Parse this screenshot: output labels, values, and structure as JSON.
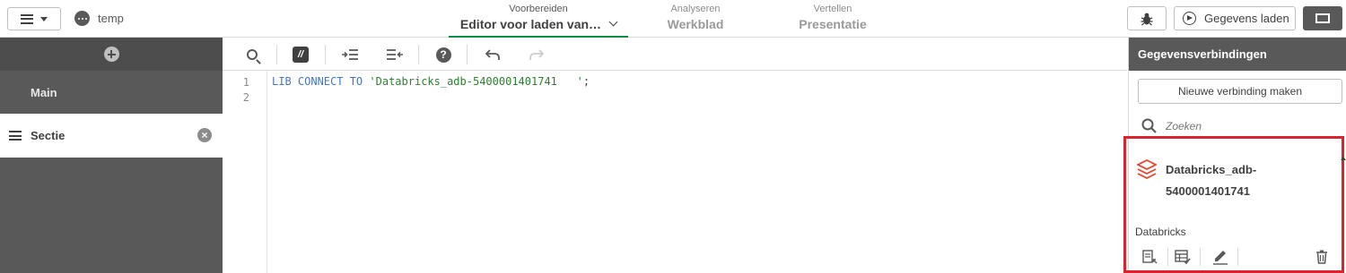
{
  "app": {
    "name": "temp"
  },
  "nav": {
    "tabs": [
      {
        "small": "Voorbereiden",
        "label": "Editor voor laden van…",
        "active": true
      },
      {
        "small": "Analyseren",
        "label": "Werkblad",
        "active": false
      },
      {
        "small": "Vertellen",
        "label": "Presentatie",
        "active": false
      }
    ]
  },
  "actions": {
    "load_label": "Gegevens laden"
  },
  "sections": {
    "items": [
      {
        "label": "Main",
        "active": false
      },
      {
        "label": "Sectie",
        "active": true
      }
    ]
  },
  "editor": {
    "line_numbers": [
      "1",
      "2"
    ],
    "code": {
      "kw1": "LIB CONNECT TO",
      "string": "'Databricks_adb-5400001401741   '",
      "end": ";"
    }
  },
  "connections_panel": {
    "title": "Gegevensverbindingen",
    "new_button": "Nieuwe verbinding maken",
    "search_placeholder": "Zoeken",
    "items": [
      {
        "name_line1": "Databricks_adb-",
        "name_line2": "5400001401741",
        "type": "Databricks"
      }
    ]
  },
  "colors": {
    "accent_green": "#0a8f45",
    "highlight_red": "#d9232e",
    "databricks_red": "#e8442e",
    "panel_grey": "#595959"
  }
}
